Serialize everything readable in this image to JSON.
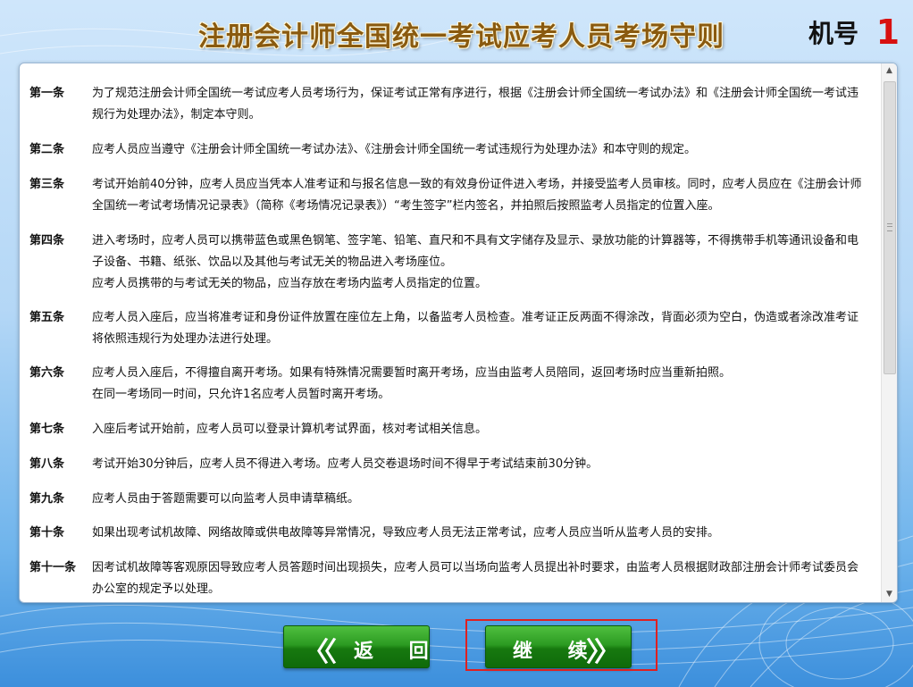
{
  "header": {
    "title": "注册会计师全国统一考试应考人员考场守则",
    "machine_label": "机号",
    "machine_number": "1"
  },
  "rules": [
    {
      "label": "第一条",
      "lines": [
        "为了规范注册会计师全国统一考试应考人员考场行为，保证考试正常有序进行，根据《注册会计师全国统一考试办法》和《注册会计师全国统一考试违规行为处理办法》，制定本守则。"
      ]
    },
    {
      "label": "第二条",
      "lines": [
        "应考人员应当遵守《注册会计师全国统一考试办法》、《注册会计师全国统一考试违规行为处理办法》和本守则的规定。"
      ]
    },
    {
      "label": "第三条",
      "lines": [
        "考试开始前40分钟，应考人员应当凭本人准考证和与报名信息一致的有效身份证件进入考场，并接受监考人员审核。同时，应考人员应在《注册会计师全国统一考试考场情况记录表》（简称《考场情况记录表》）“考生签字”栏内签名，并拍照后按照监考人员指定的位置入座。"
      ]
    },
    {
      "label": "第四条",
      "lines": [
        "进入考场时，应考人员可以携带蓝色或黑色钢笔、签字笔、铅笔、直尺和不具有文字储存及显示、录放功能的计算器等，不得携带手机等通讯设备和电子设备、书籍、纸张、饮品以及其他与考试无关的物品进入考场座位。",
        "应考人员携带的与考试无关的物品，应当存放在考场内监考人员指定的位置。"
      ]
    },
    {
      "label": "第五条",
      "lines": [
        "应考人员入座后，应当将准考证和身份证件放置在座位左上角，以备监考人员检查。准考证正反两面不得涂改，背面必须为空白，伪造或者涂改准考证将依照违规行为处理办法进行处理。"
      ]
    },
    {
      "label": "第六条",
      "lines": [
        "应考人员入座后，不得擅自离开考场。如果有特殊情况需要暂时离开考场，应当由监考人员陪同，返回考场时应当重新拍照。",
        "在同一考场同一时间，只允许1名应考人员暂时离开考场。"
      ]
    },
    {
      "label": "第七条",
      "lines": [
        "入座后考试开始前，应考人员可以登录计算机考试界面，核对考试相关信息。"
      ]
    },
    {
      "label": "第八条",
      "lines": [
        "考试开始30分钟后，应考人员不得进入考场。应考人员交卷退场时间不得早于考试结束前30分钟。"
      ]
    },
    {
      "label": "第九条",
      "lines": [
        "应考人员由于答题需要可以向监考人员申请草稿纸。"
      ]
    },
    {
      "label": "第十条",
      "lines": [
        "如果出现考试机故障、网络故障或供电故障等异常情况，导致应考人员无法正常考试，应考人员应当听从监考人员的安排。"
      ]
    },
    {
      "label": "第十一条",
      "lines": [
        "因考试机故障等客观原因导致应考人员答题时间出现损失，应考人员可以当场向监考人员提出补时要求，由监考人员根据财政部注册会计师考试委员会办公室的规定予以处理。"
      ]
    }
  ],
  "buttons": {
    "back_label": "返 回",
    "next_label": "继 续"
  }
}
